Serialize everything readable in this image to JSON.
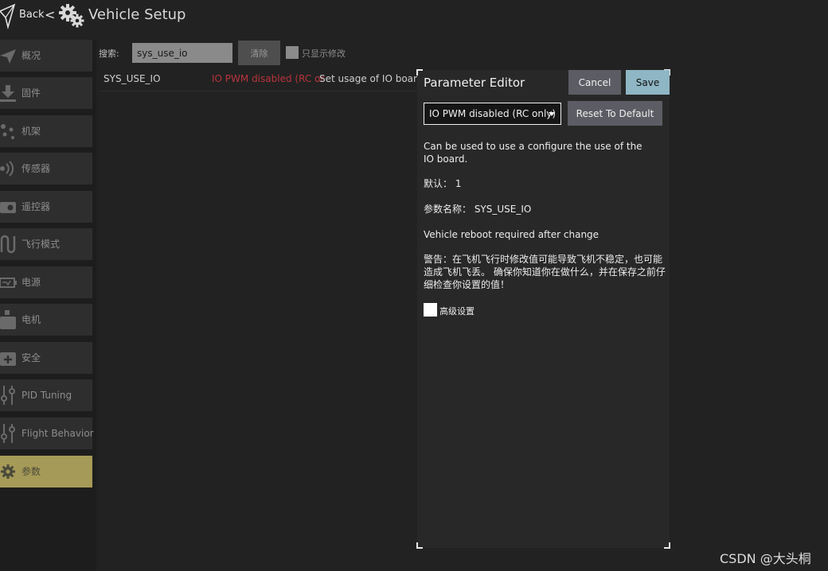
{
  "header": {
    "back_label": "Back",
    "separator": "<",
    "title": "Vehicle Setup"
  },
  "sidebar": {
    "items": [
      {
        "label": "概况",
        "icon": "paper-plane-icon",
        "active": false
      },
      {
        "label": "固件",
        "icon": "download-icon",
        "active": false
      },
      {
        "label": "机架",
        "icon": "airframe-icon",
        "active": false
      },
      {
        "label": "传感器",
        "icon": "radio-waves-icon",
        "active": false
      },
      {
        "label": "遥控器",
        "icon": "remote-control-icon",
        "active": false
      },
      {
        "label": "飞行模式",
        "icon": "flight-mode-icon",
        "active": false
      },
      {
        "label": "电源",
        "icon": "battery-icon",
        "active": false
      },
      {
        "label": "电机",
        "icon": "motor-icon",
        "active": false
      },
      {
        "label": "安全",
        "icon": "first-aid-icon",
        "active": false
      },
      {
        "label": "PID Tuning",
        "icon": "sliders-icon",
        "active": false
      },
      {
        "label": "Flight Behavior",
        "icon": "sliders-icon",
        "active": false
      },
      {
        "label": "参数",
        "icon": "gear-icon",
        "active": true
      }
    ]
  },
  "search": {
    "label": "搜索:",
    "value": "sys_use_io",
    "clear_label": "清除",
    "modified_only_label": "只显示修改"
  },
  "params": [
    {
      "name": "SYS_USE_IO",
      "value": "IO PWM disabled (RC or",
      "description": "Set usage of IO board"
    }
  ],
  "dialog": {
    "title": "Parameter Editor",
    "cancel_label": "Cancel",
    "save_label": "Save",
    "selected_value": "IO PWM disabled (RC only)",
    "reset_label": "Reset To Default",
    "description": "Can be used to use a configure the use of the IO board.",
    "default_text": "默认： 1",
    "param_name_text": "参数名称： SYS_USE_IO",
    "reboot_text": "Vehicle reboot required after change",
    "warning_text": "警告：在飞机飞行时修改值可能导致飞机不稳定，也可能造成飞机飞丢。 确保你知道你在做什么，并在保存之前仔细检查你设置的值！",
    "advanced_label": "高级设置"
  },
  "watermark": "CSDN @大头桐",
  "colors": {
    "background": "#222222",
    "sidebar_item": "#2e2e2e",
    "active_item": "#a69a58",
    "value_red": "#b8343c",
    "save_button": "#8fb6c4",
    "neutral_button": "#5c5c64"
  }
}
